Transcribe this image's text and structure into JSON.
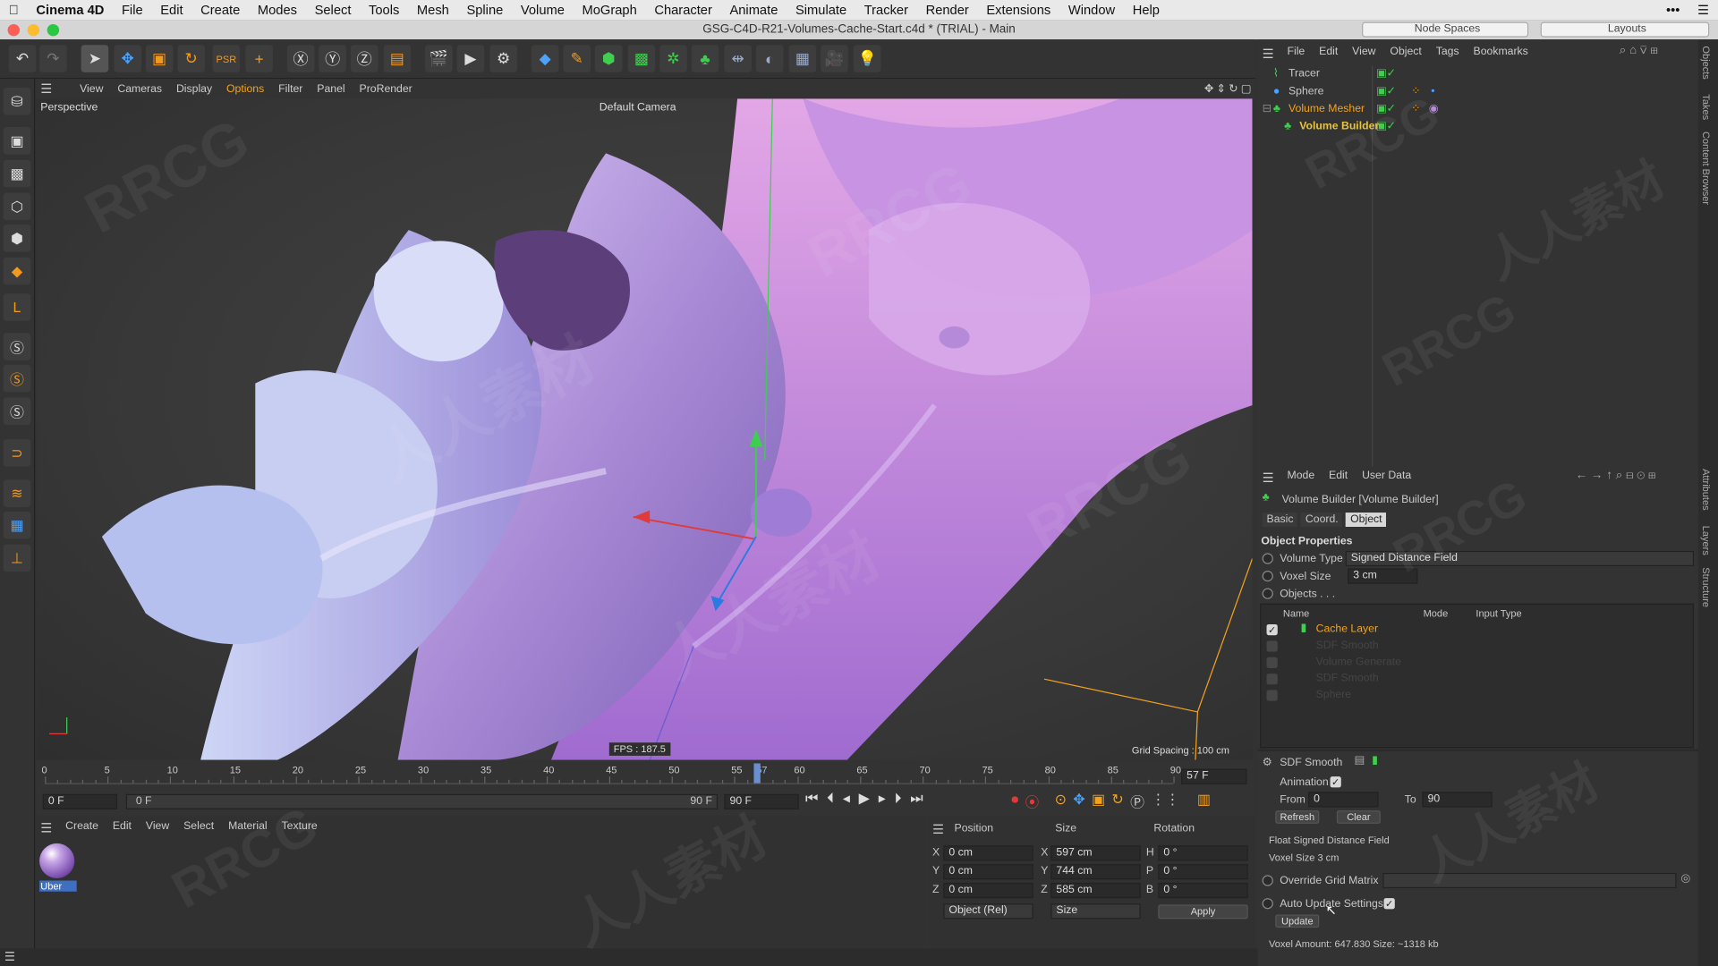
{
  "menubar": {
    "app": "Cinema 4D",
    "items": [
      "File",
      "Edit",
      "Create",
      "Modes",
      "Select",
      "Tools",
      "Mesh",
      "Spline",
      "Volume",
      "MoGraph",
      "Character",
      "Animate",
      "Simulate",
      "Tracker",
      "Render",
      "Extensions",
      "Window",
      "Help"
    ]
  },
  "title": "GSG-C4D-R21-Volumes-Cache-Start.c4d * (TRIAL) - Main",
  "node_spaces": "Node Spaces",
  "layouts": "Layouts",
  "viewport": {
    "menu": [
      "View",
      "Cameras",
      "Display",
      "Options",
      "Filter",
      "Panel",
      "ProRender"
    ],
    "label": "Perspective",
    "camera": "Default Camera",
    "fps": "FPS : 187.5",
    "grid": "Grid Spacing : 100 cm"
  },
  "timeline": {
    "ticks": [
      "0",
      "5",
      "10",
      "15",
      "20",
      "25",
      "30",
      "35",
      "40",
      "45",
      "50",
      "55",
      "57",
      "60",
      "65",
      "70",
      "75",
      "80",
      "85",
      "90"
    ],
    "current_frame": "57 F",
    "start": "0 F",
    "start2": "0 F",
    "end": "90 F",
    "end2": "90 F"
  },
  "materials": {
    "menu": [
      "Create",
      "Edit",
      "View",
      "Select",
      "Material",
      "Texture"
    ],
    "item": "Uber"
  },
  "coords": {
    "headers": [
      "Position",
      "Size",
      "Rotation"
    ],
    "axes": [
      "X",
      "Y",
      "Z"
    ],
    "pos": [
      "0 cm",
      "0 cm",
      "0 cm"
    ],
    "size": [
      "597 cm",
      "744 cm",
      "585 cm"
    ],
    "rot_labels": [
      "H",
      "P",
      "B"
    ],
    "rot": [
      "0 °",
      "0 °",
      "0 °"
    ],
    "mode": "Object (Rel)",
    "size_mode": "Size",
    "apply": "Apply"
  },
  "objmgr": {
    "menu": [
      "File",
      "Edit",
      "View",
      "Object",
      "Tags",
      "Bookmarks"
    ],
    "items": [
      "Tracer",
      "Sphere",
      "Volume Mesher",
      "Volume Builder"
    ]
  },
  "attr": {
    "menu": [
      "Mode",
      "Edit",
      "User Data"
    ],
    "title": "Volume Builder [Volume Builder]",
    "tabs": [
      "Basic",
      "Coord.",
      "Object"
    ],
    "section": "Object Properties",
    "volume_type_label": "Volume Type",
    "volume_type": "Signed Distance Field",
    "voxel_label": "Voxel Size",
    "voxel": "3 cm",
    "objects_label": "Objects . . .",
    "cols": [
      "Name",
      "Mode",
      "Input Type"
    ],
    "layers": [
      "Cache Layer",
      "SDF Smooth",
      "Volume Generate",
      "SDF Smooth",
      "Sphere"
    ],
    "sub_title": "SDF Smooth",
    "animation": "Animation",
    "from_label": "From",
    "from": "0",
    "to_label": "To",
    "to": "90",
    "refresh": "Refresh",
    "clear": "Clear",
    "info1": "Float Signed Distance Field",
    "info2": "Voxel Size 3 cm",
    "override": "Override Grid Matrix",
    "auto": "Auto Update Settings",
    "update": "Update",
    "amount": "Voxel Amount: 647.830  Size: ~1318 kb"
  },
  "rstrip": [
    "Objects",
    "Takes",
    "Content Browser",
    "Attributes",
    "Layers",
    "Structure"
  ],
  "watermarks": [
    "RRCG",
    "人人素材"
  ],
  "colors": {
    "accent": "#f4a21b",
    "selected": "#e8c43a",
    "mesh": "#b48cd8"
  }
}
